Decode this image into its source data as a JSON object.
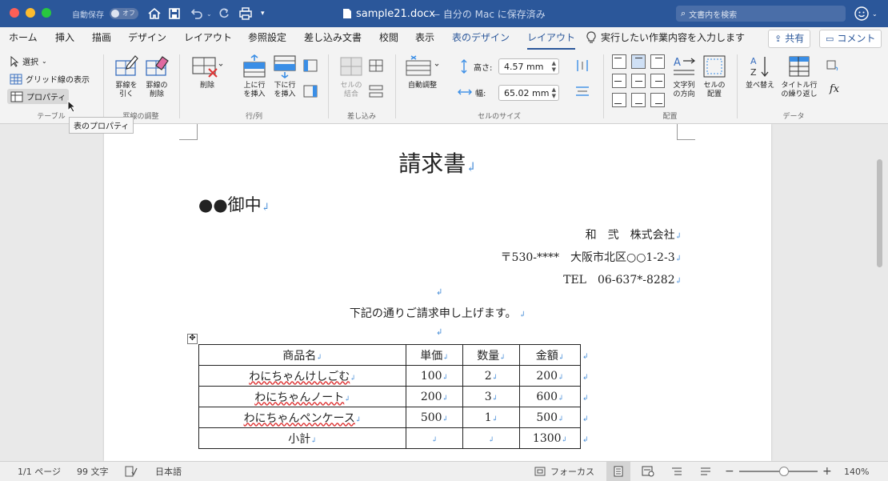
{
  "title_bar": {
    "autosave_label": "自動保存",
    "autosave_state": "オフ",
    "doc_name": "sample21.docx",
    "doc_status": "— 自分の Mac に保存済み",
    "search_placeholder": "文書内を検索"
  },
  "tabs": [
    "ホーム",
    "挿入",
    "描画",
    "デザイン",
    "レイアウト",
    "参照設定",
    "差し込み文書",
    "校閲",
    "表示",
    "表のデザイン",
    "レイアウト"
  ],
  "tell_me": "実行したい作業内容を入力します",
  "share_label": "共有",
  "comment_label": "コメント",
  "ribbon": {
    "table_group": {
      "label": "テーブル",
      "select": "選択",
      "gridlines": "グリッド線の表示",
      "properties": "プロパティ",
      "tooltip": "表のプロパティ"
    },
    "draw_group": {
      "label": "罫線の調整",
      "draw": [
        "罫線を",
        "引く"
      ],
      "erase": [
        "罫線の",
        "削除"
      ]
    },
    "rowcol_group": {
      "label": "行/列",
      "delete": "削除",
      "insert_above": [
        "上に行",
        "を挿入"
      ],
      "insert_below": [
        "下に行",
        "を挿入"
      ]
    },
    "merge_group": {
      "label": "差し込み",
      "merge": [
        "セルの",
        "結合"
      ]
    },
    "cellsize_group": {
      "label": "セルのサイズ",
      "autofit": "自動調整",
      "height_label": "高さ:",
      "height_value": "4.57 mm",
      "width_label": "幅:",
      "width_value": "65.02 mm"
    },
    "align_group": {
      "label": "配置",
      "direction": [
        "文字列",
        "の方向"
      ],
      "margins": [
        "セルの",
        "配置"
      ]
    },
    "data_group": {
      "label": "データ",
      "sort": "並べ替え",
      "repeat_header": [
        "タイトル行",
        "の繰り返し"
      ],
      "formula": "fx"
    }
  },
  "document": {
    "title": "請求書",
    "addressee": "●●御中",
    "company": "和　弐　株式会社",
    "address": "〒530-****　大阪市北区○○1-2-3",
    "tel": "TEL　06-637*-8282",
    "intro": "下記の通りご請求申し上げます。",
    "table": {
      "headers": [
        "商品名",
        "単価",
        "数量",
        "金額"
      ],
      "rows": [
        [
          "わにちゃんけしごむ",
          "100",
          "2",
          "200"
        ],
        [
          "わにちゃんノート",
          "200",
          "3",
          "600"
        ],
        [
          "わにちゃんペンケース",
          "500",
          "1",
          "500"
        ],
        [
          "小計",
          "",
          "",
          "1300"
        ]
      ]
    }
  },
  "status_bar": {
    "page": "1/1 ページ",
    "words": "99 文字",
    "language": "日本語",
    "focus": "フォーカス",
    "zoom": "140%",
    "zoom_fraction": 0.58
  }
}
